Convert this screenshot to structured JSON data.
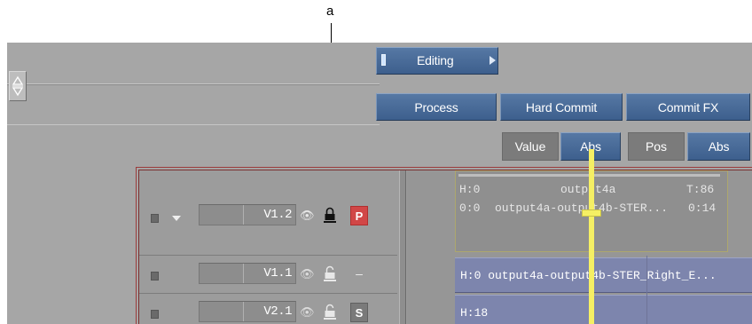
{
  "callout": {
    "label": "a"
  },
  "buttons": {
    "editing": "Editing",
    "process": "Process",
    "hard_commit": "Hard Commit",
    "commit_fx": "Commit FX"
  },
  "value_row": {
    "value_label": "Value",
    "value_mode": "Abs",
    "pos_label": "Pos",
    "pos_mode": "Abs"
  },
  "tracks": [
    {
      "name": "V1.2",
      "badge": "P"
    },
    {
      "name": "V1.1",
      "badge": "–"
    },
    {
      "name": "V2.1",
      "badge": "S"
    }
  ],
  "clips": {
    "selected": {
      "top_left": "H:0",
      "top_center": "output4a",
      "top_right": "T:86",
      "bottom_left": "0:0",
      "bottom_center": "output4a-output4b-STER...",
      "bottom_right": "0:14"
    },
    "v11": "H:0  output4a-output4b-STER_Right_E...",
    "v21": "H:18"
  },
  "icons": {
    "up_down": "up-down-arrows-icon",
    "eye": "eye-icon",
    "lock": "lock-icon",
    "disclose": "disclosure-triangle-icon"
  },
  "colors": {
    "button_blue": "#4a6b97",
    "playhead": "#f5ef64",
    "clip_blue": "#7d85ad",
    "primary_badge": "#d14747",
    "timeline_border": "#9b3b3b"
  }
}
